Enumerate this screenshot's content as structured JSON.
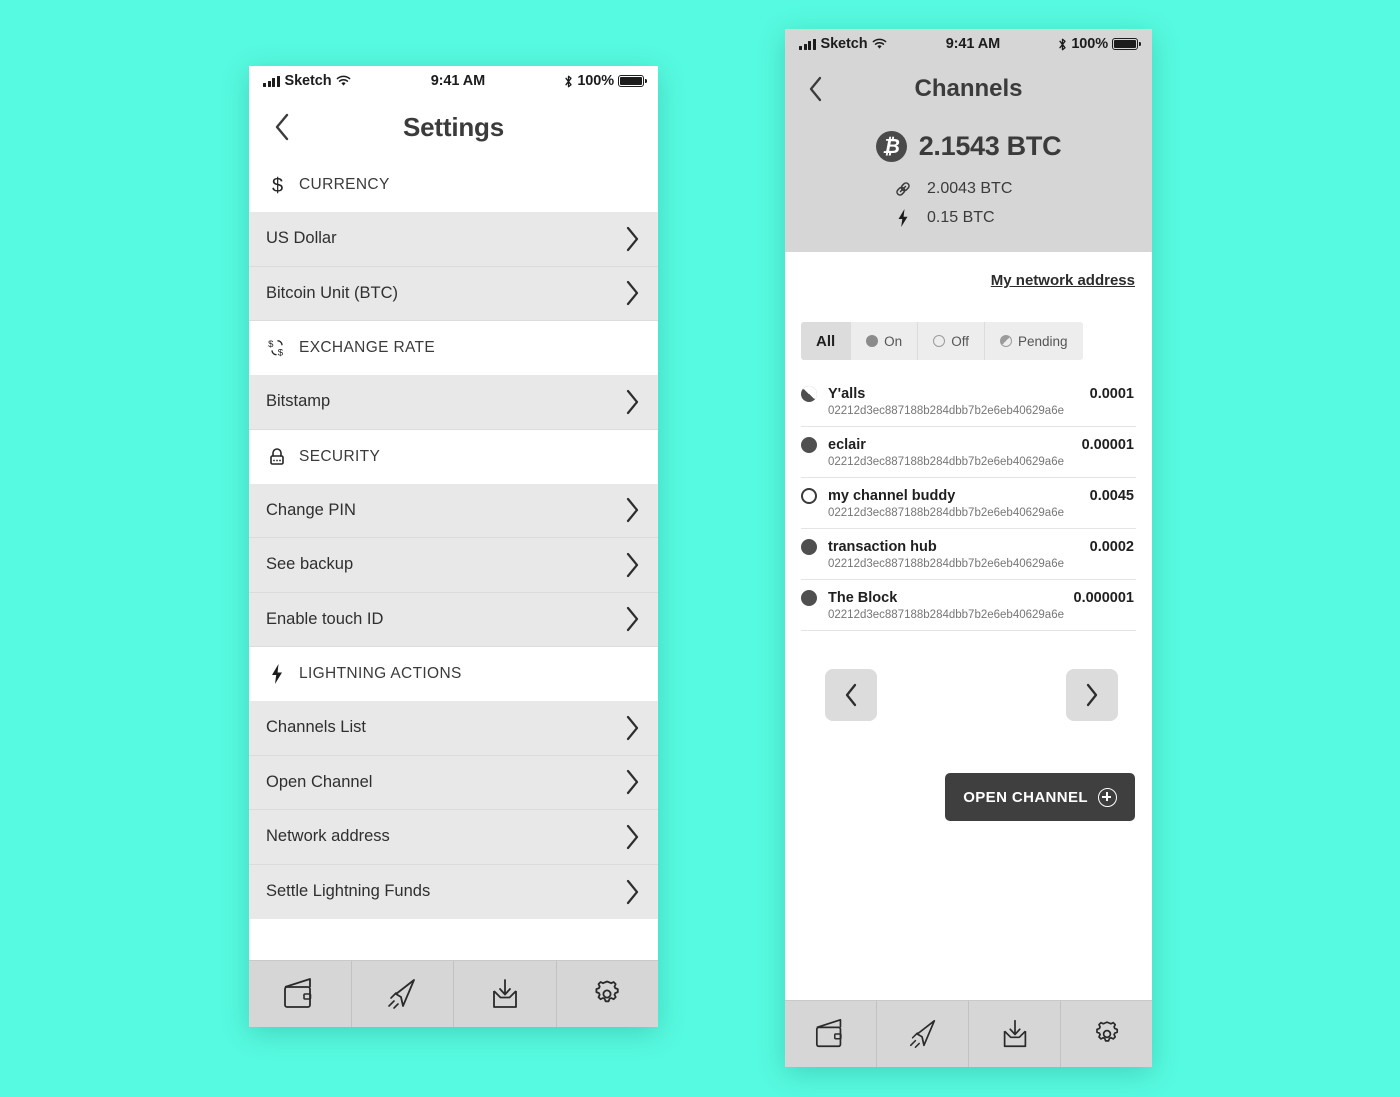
{
  "canvas": {
    "background_color": "#56FAE0"
  },
  "phone_left": {
    "status_bar": {
      "carrier": "Sketch",
      "time": "9:41 AM",
      "battery_percent": "100%"
    },
    "nav": {
      "title": "Settings",
      "back_icon": "chevron-left-icon"
    },
    "sections": [
      {
        "icon": "dollar-icon",
        "label": "CURRENCY",
        "rows": [
          {
            "label": "US Dollar"
          },
          {
            "label": "Bitcoin Unit (BTC)"
          }
        ]
      },
      {
        "icon": "exchange-rate-icon",
        "label": "EXCHANGE RATE",
        "rows": [
          {
            "label": "Bitstamp"
          }
        ]
      },
      {
        "icon": "lock-icon",
        "label": "SECURITY",
        "rows": [
          {
            "label": "Change PIN"
          },
          {
            "label": "See backup"
          },
          {
            "label": "Enable touch ID"
          }
        ]
      },
      {
        "icon": "lightning-bolt-icon",
        "label": "LIGHTNING ACTIONS",
        "rows": [
          {
            "label": "Channels List"
          },
          {
            "label": "Open Channel"
          },
          {
            "label": "Network address"
          },
          {
            "label": "Settle Lightning Funds"
          }
        ]
      }
    ],
    "tabbar": [
      {
        "icon": "wallet-icon",
        "name": "wallet"
      },
      {
        "icon": "send-icon",
        "name": "send"
      },
      {
        "icon": "receive-icon",
        "name": "receive"
      },
      {
        "icon": "gear-icon",
        "name": "settings"
      }
    ]
  },
  "phone_right": {
    "status_bar": {
      "carrier": "Sketch",
      "time": "9:41 AM",
      "battery_percent": "100%"
    },
    "nav": {
      "title": "Channels",
      "back_icon": "chevron-left-icon"
    },
    "balance": {
      "total": "2.1543 BTC",
      "badge_glyph": "₿",
      "onchain": {
        "icon": "chain-link-icon",
        "amount": "2.0043 BTC"
      },
      "lightning": {
        "icon": "lightning-bolt-icon",
        "amount": "0.15 BTC"
      }
    },
    "network_address_link": "My network address",
    "filters": [
      {
        "label": "All",
        "state": "active",
        "marker": "none"
      },
      {
        "label": "On",
        "state": "inactive",
        "marker": "filled-circle"
      },
      {
        "label": "Off",
        "state": "inactive",
        "marker": "hollow-circle"
      },
      {
        "label": "Pending",
        "state": "inactive",
        "marker": "half-circle"
      }
    ],
    "channels": [
      {
        "status": "pending",
        "name": "Y'alls",
        "amount": "0.0001",
        "node_id": "02212d3ec887188b284dbb7b2e6eb40629a6e"
      },
      {
        "status": "on",
        "name": "eclair",
        "amount": "0.00001",
        "node_id": "02212d3ec887188b284dbb7b2e6eb40629a6e"
      },
      {
        "status": "off",
        "name": "my channel buddy",
        "amount": "0.0045",
        "node_id": "02212d3ec887188b284dbb7b2e6eb40629a6e"
      },
      {
        "status": "on",
        "name": "transaction hub",
        "amount": "0.0002",
        "node_id": "02212d3ec887188b284dbb7b2e6eb40629a6e"
      },
      {
        "status": "on",
        "name": "The Block",
        "amount": "0.000001",
        "node_id": "02212d3ec887188b284dbb7b2e6eb40629a6e"
      }
    ],
    "pager": {
      "prev_icon": "chevron-left-icon",
      "next_icon": "chevron-right-icon"
    },
    "open_channel_button": {
      "label": "OPEN CHANNEL",
      "icon": "plus-circle-icon"
    },
    "tabbar": [
      {
        "icon": "wallet-icon",
        "name": "wallet"
      },
      {
        "icon": "send-icon",
        "name": "send"
      },
      {
        "icon": "receive-icon",
        "name": "receive"
      },
      {
        "icon": "gear-icon",
        "name": "settings"
      }
    ]
  }
}
